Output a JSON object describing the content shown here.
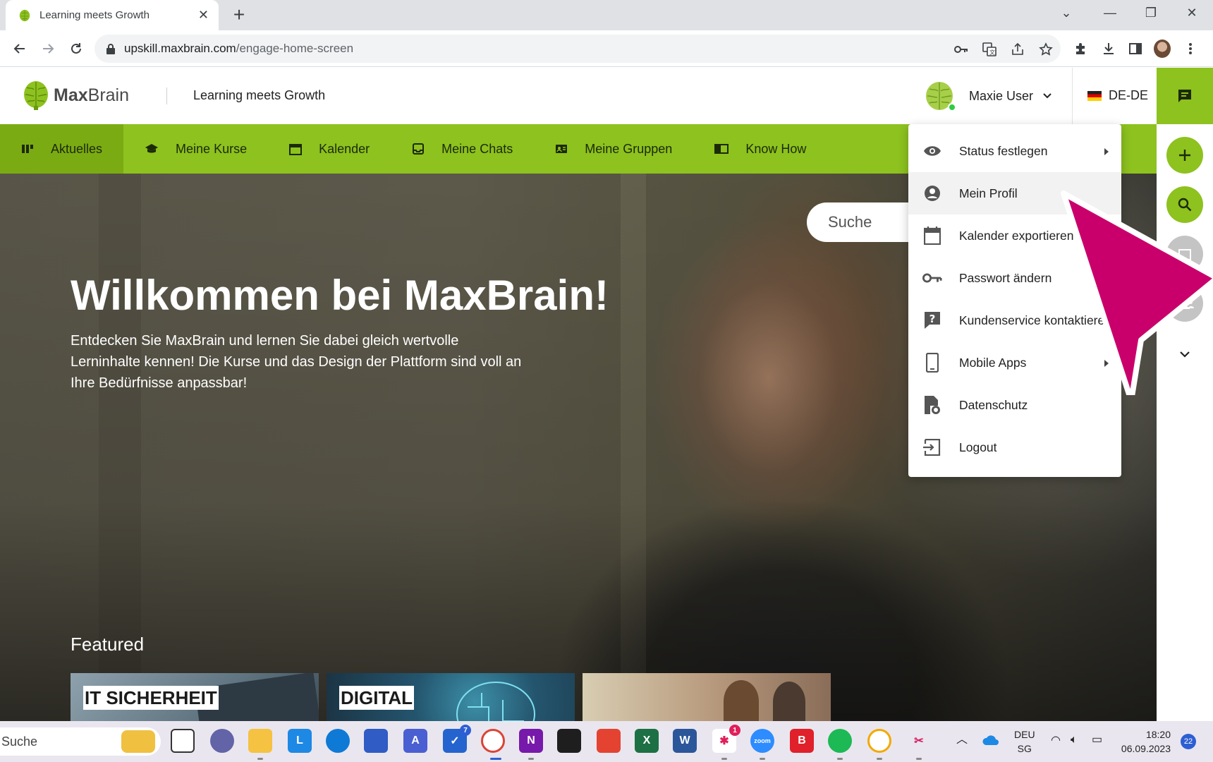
{
  "browser": {
    "tab_title": "Learning meets Growth",
    "url_host": "upskill.maxbrain.com",
    "url_path": "/engage-home-screen"
  },
  "header": {
    "logo_bold": "Max",
    "logo_light": "Brain",
    "tagline": "Learning meets Growth",
    "user_name": "Maxie User",
    "language": "DE-DE"
  },
  "nav": {
    "items": [
      {
        "label": "Aktuelles",
        "icon": "news-icon"
      },
      {
        "label": "Meine Kurse",
        "icon": "graduation-cap-icon"
      },
      {
        "label": "Kalender",
        "icon": "calendar-icon"
      },
      {
        "label": "Meine Chats",
        "icon": "inbox-icon"
      },
      {
        "label": "Meine Gruppen",
        "icon": "contact-card-icon"
      },
      {
        "label": "Know How",
        "icon": "book-icon"
      }
    ]
  },
  "hero": {
    "search_placeholder": "Suche",
    "title": "Willkommen bei MaxBrain!",
    "text": "Entdecken Sie MaxBrain und lernen Sie dabei gleich wertvolle Lerninhalte kennen! Die Kurse und das Design der Plattform sind voll an Ihre Bedürfnisse anpassbar!",
    "featured_title": "Featured",
    "cards": [
      {
        "label": "IT SICHERHEIT"
      },
      {
        "label": "DIGITAL"
      },
      {
        "label": ""
      }
    ]
  },
  "user_menu": {
    "items": [
      {
        "label": "Status festlegen",
        "icon": "eye-icon",
        "submenu": true
      },
      {
        "label": "Mein Profil",
        "icon": "account-icon",
        "submenu": false
      },
      {
        "label": "Kalender exportieren",
        "icon": "calendar-icon",
        "submenu": false
      },
      {
        "label": "Passwort ändern",
        "icon": "key-icon",
        "submenu": false
      },
      {
        "label": "Kundenservice kontaktieren",
        "icon": "help-icon",
        "submenu": false
      },
      {
        "label": "Mobile Apps",
        "icon": "phone-icon",
        "submenu": true
      },
      {
        "label": "Datenschutz",
        "icon": "document-shield-icon",
        "submenu": false
      },
      {
        "label": "Logout",
        "icon": "logout-icon",
        "submenu": false
      }
    ]
  },
  "taskbar": {
    "search_placeholder": "Suche",
    "lang_top": "DEU",
    "lang_bottom": "SG",
    "time": "18:20",
    "date": "06.09.2023",
    "notifications": "22",
    "todo_badge": "7",
    "slack_badge": "1"
  },
  "colors": {
    "brand_green": "#8dc21f",
    "annotation_magenta": "#c9006b"
  }
}
